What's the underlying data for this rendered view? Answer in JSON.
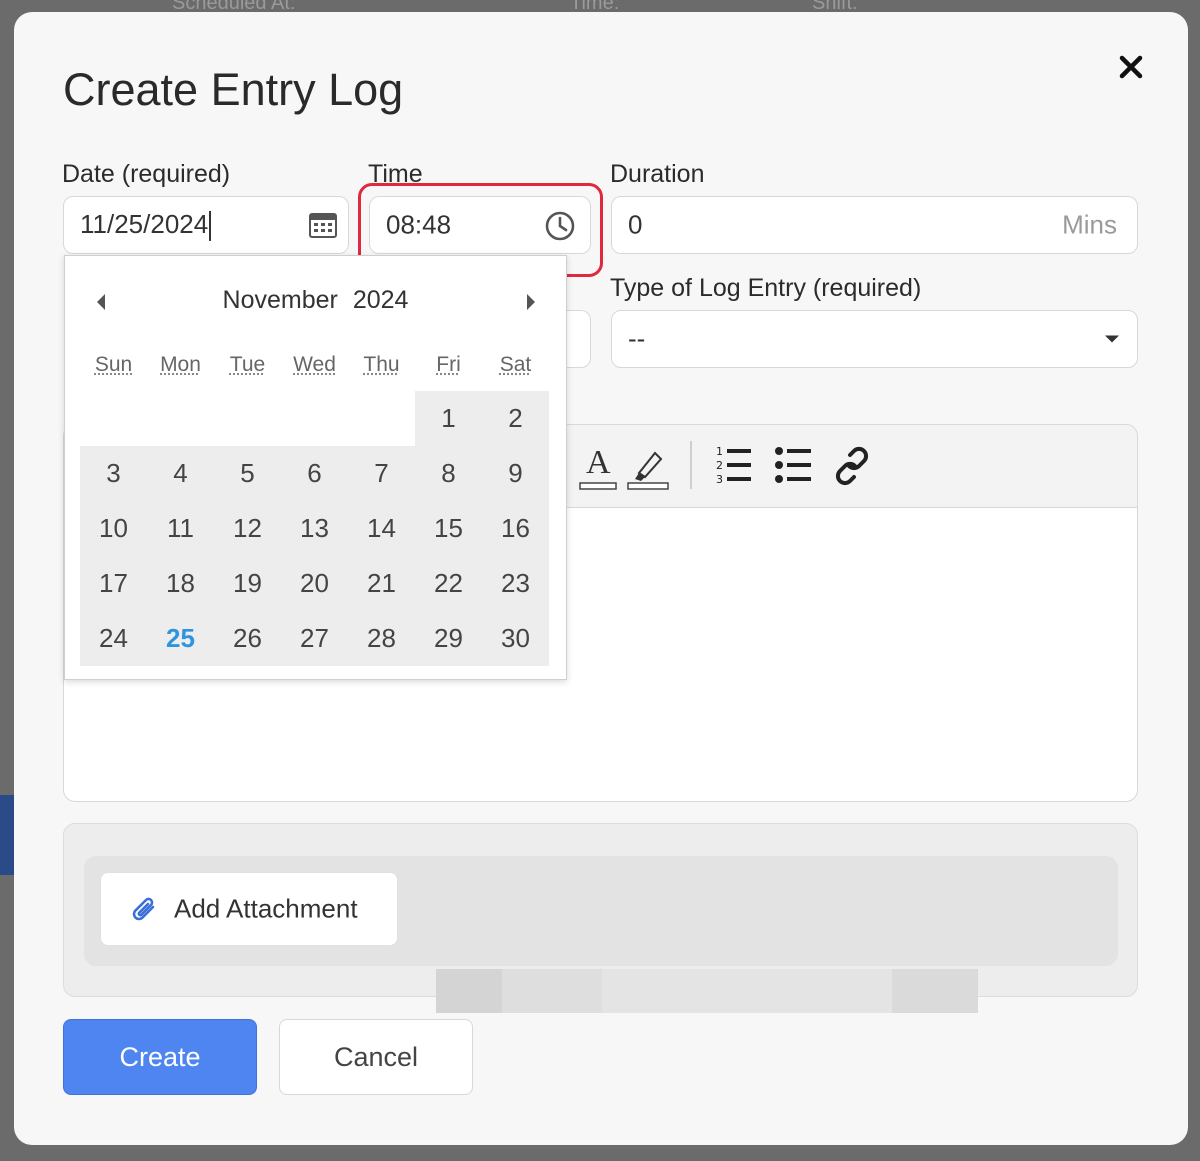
{
  "background": {
    "label_a": "Scheduled At:",
    "label_b": "Time:",
    "label_c": "Shift:"
  },
  "modal": {
    "title": "Create Entry Log",
    "close_icon": "close-icon"
  },
  "fields": {
    "date_label": "Date (required)",
    "date_value": "11/25/2024",
    "time_label": "Time",
    "time_value": "08:48",
    "duration_label": "Duration",
    "duration_value": "0",
    "duration_suffix": "Mins",
    "type_label": "Type of Log Entry (required)",
    "type_value": "--"
  },
  "calendar": {
    "month": "November",
    "year": "2024",
    "weekdays": [
      "Sun",
      "Mon",
      "Tue",
      "Wed",
      "Thu",
      "Fri",
      "Sat"
    ],
    "weeks": [
      [
        "",
        "",
        "",
        "",
        "",
        "1",
        "2"
      ],
      [
        "3",
        "4",
        "5",
        "6",
        "7",
        "8",
        "9"
      ],
      [
        "10",
        "11",
        "12",
        "13",
        "14",
        "15",
        "16"
      ],
      [
        "17",
        "18",
        "19",
        "20",
        "21",
        "22",
        "23"
      ],
      [
        "24",
        "25",
        "26",
        "27",
        "28",
        "29",
        "30"
      ]
    ],
    "today": "25"
  },
  "toolbar": {
    "items": [
      "font-color-icon",
      "highlight-icon",
      "ordered-list-icon",
      "bullet-list-icon",
      "link-icon"
    ]
  },
  "attachment": {
    "button_label": "Add Attachment",
    "icon": "paperclip-icon"
  },
  "actions": {
    "create_label": "Create",
    "cancel_label": "Cancel"
  },
  "colors": {
    "primary": "#4f85f0",
    "highlight": "#e0283f",
    "today": "#2f94e0"
  }
}
